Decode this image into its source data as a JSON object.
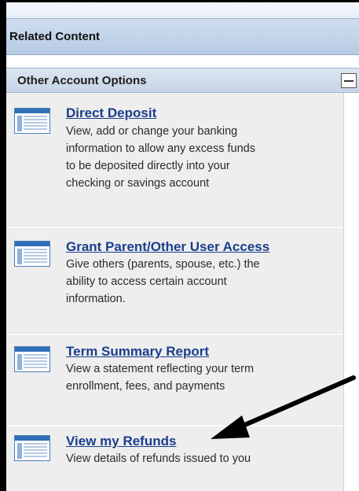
{
  "header": {
    "title": "Related Content"
  },
  "section": {
    "title": "Other Account Options",
    "collapse_icon": "minus-box-icon"
  },
  "items": [
    {
      "title": "Direct Deposit",
      "desc_lines": [
        "View, add or change your banking",
        "information to allow any excess funds",
        "to be deposited directly into your",
        "checking or savings account"
      ],
      "icon": "page-list-icon"
    },
    {
      "title": "Grant Parent/Other User Access",
      "desc_lines": [
        "Give others (parents, spouse, etc.) the",
        "ability to access certain account",
        "information."
      ],
      "icon": "page-list-icon"
    },
    {
      "title": "Term Summary Report",
      "desc_lines": [
        "View a statement reflecting your term",
        "enrollment, fees, and payments"
      ],
      "icon": "page-list-icon"
    },
    {
      "title": "View my Refunds",
      "desc_lines": [
        "View details of refunds issued to you"
      ],
      "icon": "page-list-icon"
    }
  ],
  "colors": {
    "link": "#1a3e8c",
    "panel_bg": "#eeeeee",
    "header_bg": "#c4d6ec"
  }
}
